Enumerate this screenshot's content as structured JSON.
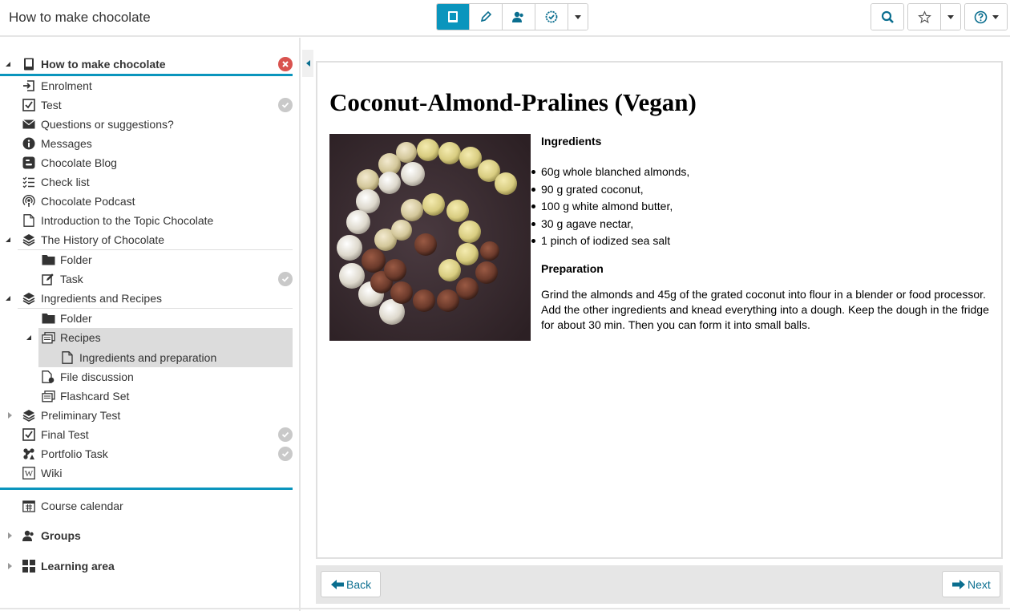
{
  "app": {
    "title": "How to make chocolate"
  },
  "toolbar": {
    "modes": [
      "course-view",
      "edit",
      "members",
      "assessment"
    ],
    "search_icon": "search-icon",
    "bookmark_icon": "star-icon",
    "help_icon": "help-icon"
  },
  "sidebar": {
    "course_title": "How to make chocolate",
    "items": {
      "enrolment": "Enrolment",
      "test": "Test",
      "questions": "Questions or suggestions?",
      "messages": "Messages",
      "blog": "Chocolate Blog",
      "checklist": "Check list",
      "podcast": "Chocolate Podcast",
      "intro": "Introduction to the Topic Chocolate",
      "history": "The History of Chocolate",
      "history_folder": "Folder",
      "history_task": "Task",
      "ingredients": "Ingredients and Recipes",
      "ing_folder": "Folder",
      "recipes": "Recipes",
      "ing_prep": "Ingredients and preparation",
      "file_discussion": "File discussion",
      "flashcards": "Flashcard Set",
      "preliminary": "Preliminary Test",
      "final_test": "Final Test",
      "portfolio": "Portfolio Task",
      "wiki": "Wiki"
    },
    "extra": {
      "calendar": "Course calendar",
      "groups": "Groups",
      "learning_area": "Learning area"
    }
  },
  "content": {
    "title": "Coconut-Almond-Pralines (Vegan)",
    "ingredients_heading": "Ingredients",
    "ingredients": [
      "60g whole blanched almonds,",
      "90 g grated coconut,",
      "100 g white almond butter,",
      "30 g agave nectar,",
      "1 pinch of iodized sea salt"
    ],
    "preparation_heading": "Preparation",
    "preparation_text": "Grind the almonds and 45g of the grated coconut into flour in a blender or food processor. Add the other ingredients and knead everything into a dough. Keep the dough in the fridge for about 30 min. Then you can form it into small balls."
  },
  "nav": {
    "back": "Back",
    "next": "Next"
  },
  "colors": {
    "accent": "#0a95bd",
    "link": "#0a6e8f",
    "close_badge": "#d9534f",
    "done_badge": "#c9c9c9"
  }
}
